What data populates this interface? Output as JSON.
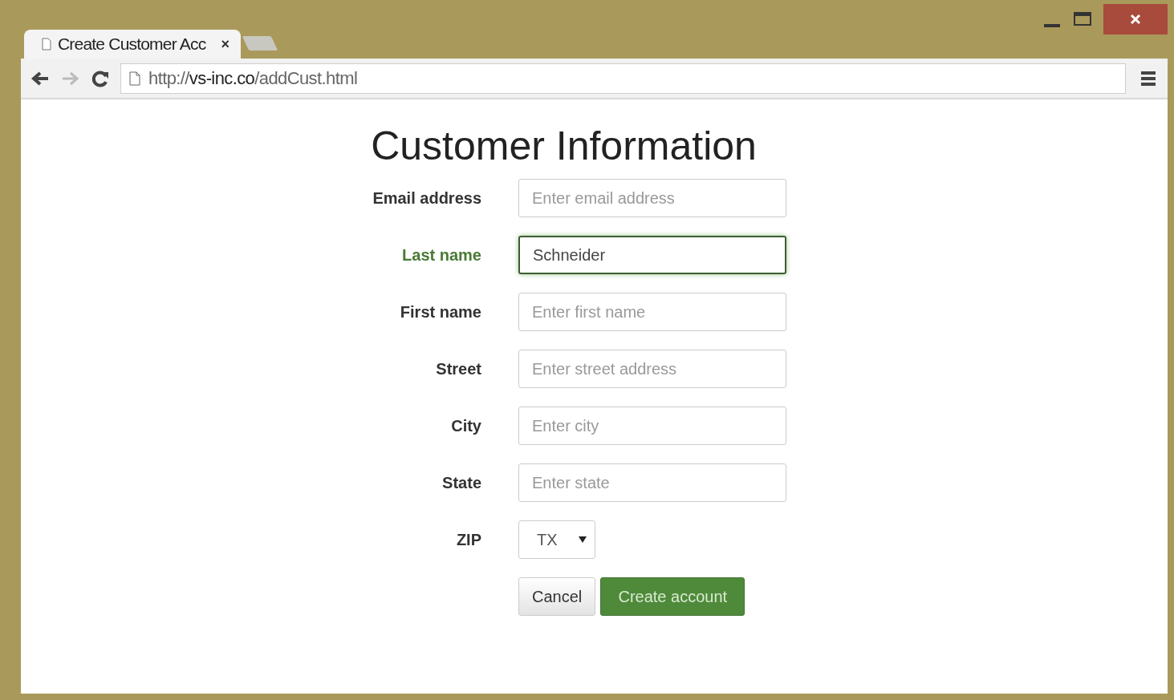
{
  "window": {
    "controls": [
      {
        "kind": "minimize"
      },
      {
        "kind": "maximize"
      },
      {
        "kind": "close"
      }
    ]
  },
  "tabs": [
    {
      "title": "Create Customer Acc",
      "close": "×",
      "selected": true
    }
  ],
  "toolbar": {
    "url": "http://**vs-inc.co**/addCust.html"
  },
  "form": {
    "title": "Customer Information",
    "fields": [
      {
        "label": "Email address",
        "kind": "text",
        "placeholder": "Enter email address",
        "focused": false
      },
      {
        "label": "Last name",
        "kind": "text",
        "value": "Schneider",
        "focused": true
      },
      {
        "label": "First name",
        "kind": "text",
        "placeholder": "Enter first name",
        "focused": false
      },
      {
        "label": "Street",
        "kind": "text",
        "placeholder": "Enter street address",
        "focused": false
      },
      {
        "label": "City",
        "kind": "text",
        "placeholder": "Enter city",
        "focused": false
      },
      {
        "label": "State",
        "kind": "text",
        "placeholder": "Enter state",
        "focused": false
      },
      {
        "label": "ZIP",
        "kind": "select",
        "value": "TX",
        "focused": false
      }
    ],
    "buttons": [
      {
        "label": "Cancel",
        "kind": "default"
      },
      {
        "label": "Create account",
        "kind": "primary"
      }
    ]
  }
}
